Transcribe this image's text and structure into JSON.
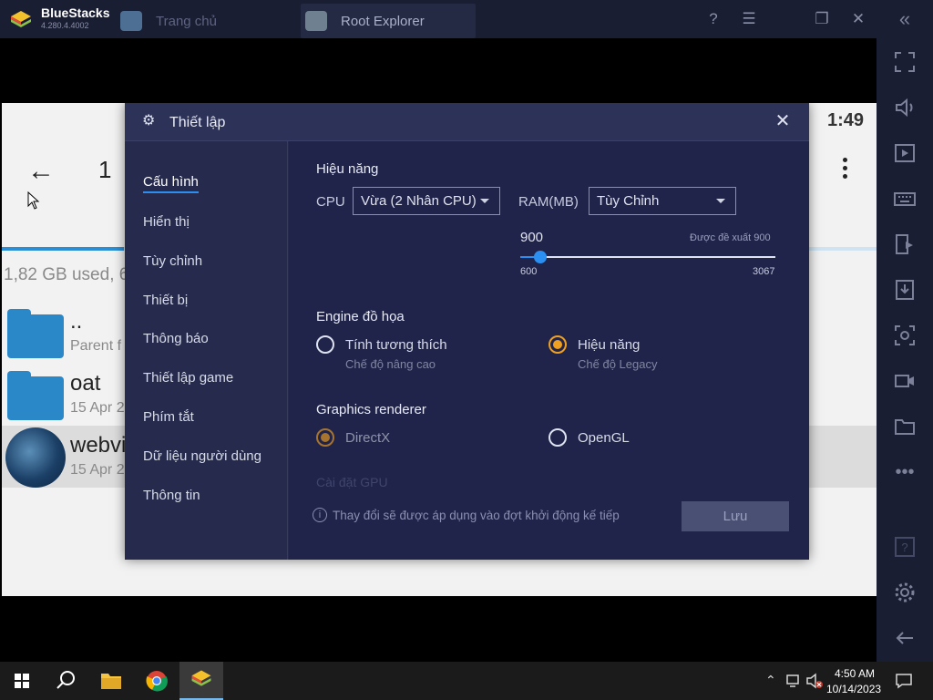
{
  "titlebar": {
    "app_name": "BlueStacks",
    "app_version": "4.280.4.4002",
    "tabs": [
      {
        "label": "Trang chủ",
        "icon": "home-app-icon"
      },
      {
        "label": "Root Explorer",
        "icon": "root-explorer-icon"
      }
    ],
    "controls": [
      {
        "name": "help",
        "glyph": "?"
      },
      {
        "name": "menu",
        "glyph": "☰"
      },
      {
        "name": "restore",
        "glyph": "❐"
      },
      {
        "name": "close",
        "glyph": "✕"
      },
      {
        "name": "collapse-sidebar",
        "glyph": "«"
      }
    ]
  },
  "sidebar": {
    "icons": [
      "fullscreen-icon",
      "volume-icon",
      "video-play-icon",
      "keyboard-icon",
      "install-apk-icon",
      "install-icon",
      "screenshot-icon",
      "record-icon",
      "folder-icon",
      "more-icon",
      "help-icon",
      "settings-icon",
      "back-icon"
    ]
  },
  "android": {
    "back": "←",
    "title": "1",
    "time": "1:49",
    "storage": "1,82 GB used, 6",
    "rows": [
      {
        "name": "..",
        "sub": "Parent f"
      },
      {
        "name": "oat",
        "sub": "15 Apr 2"
      },
      {
        "name": "webvi",
        "sub": "15 Apr 2"
      }
    ]
  },
  "dialog": {
    "title": "Thiết lập",
    "nav": [
      "Cấu hình",
      "Hiển thị",
      "Tùy chỉnh",
      "Thiết bị",
      "Thông báo",
      "Thiết lập game",
      "Phím tắt",
      "Dữ liệu người dùng",
      "Thông tin"
    ],
    "active_nav": 0,
    "performance": {
      "title": "Hiệu năng",
      "cpu_label": "CPU",
      "cpu_value": "Vừa (2 Nhân CPU)",
      "ram_label": "RAM(MB)",
      "ram_value": "Tùy Chỉnh",
      "slider_value": "900",
      "slider_recommended": "Được đề xuất 900",
      "slider_min": "600",
      "slider_max": "3067",
      "slider_fraction": 0.08
    },
    "engine": {
      "title": "Engine đồ họa",
      "options": [
        {
          "label": "Tính tương thích",
          "sub": "Chế độ nâng cao",
          "selected": false
        },
        {
          "label": "Hiệu năng",
          "sub": "Chế độ Legacy",
          "selected": true
        }
      ]
    },
    "renderer": {
      "title": "Graphics renderer",
      "options": [
        {
          "label": "DirectX",
          "selected": true
        },
        {
          "label": "OpenGL",
          "selected": false
        }
      ]
    },
    "faded_text": "Cài đặt GPU",
    "info": "Thay đổi sẽ được áp dụng vào đợt khởi động kế tiếp",
    "save": "Lưu"
  },
  "taskbar": {
    "time": "4:50 AM",
    "date": "10/14/2023",
    "apps": [
      "windows-start-icon",
      "search-icon",
      "file-explorer-icon",
      "chrome-icon",
      "bluestacks-icon"
    ]
  },
  "colors": {
    "accent": "#2a8ff0",
    "radio_on": "#f0a020",
    "dialog_bg": "#20244a",
    "titlebar_bg": "#1a1e33"
  }
}
